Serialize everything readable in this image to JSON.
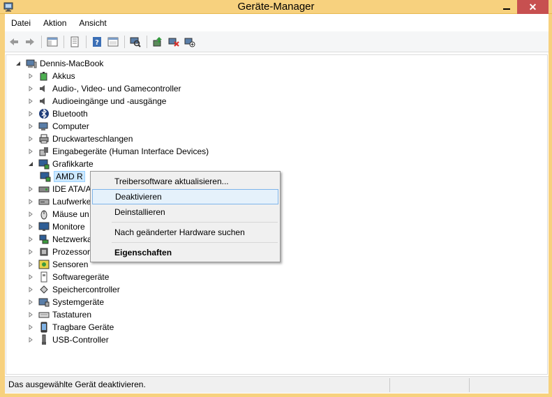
{
  "window": {
    "title": "Geräte-Manager"
  },
  "menu": [
    "Datei",
    "Aktion",
    "Ansicht"
  ],
  "toolbar": [
    "back-icon",
    "forward-icon",
    "show-hide-tree-icon",
    "properties-icon",
    "help-icon",
    "view-icon",
    "scan-hardware-icon",
    "update-driver-icon",
    "uninstall-icon",
    "disable-icon"
  ],
  "tree": {
    "root": "Dennis-MacBook",
    "items": [
      {
        "label": "Akkus",
        "icon": "battery-icon"
      },
      {
        "label": "Audio-, Video- und Gamecontroller",
        "icon": "speaker-icon"
      },
      {
        "label": "Audioeingänge und -ausgänge",
        "icon": "speaker-icon"
      },
      {
        "label": "Bluetooth",
        "icon": "bluetooth-icon"
      },
      {
        "label": "Computer",
        "icon": "computer-icon"
      },
      {
        "label": "Druckwarteschlangen",
        "icon": "printer-icon"
      },
      {
        "label": "Eingabegeräte (Human Interface Devices)",
        "icon": "hid-icon"
      },
      {
        "label": "Grafikkarte",
        "icon": "display-adapter-icon"
      },
      {
        "label": "AMD R",
        "icon": "display-adapter-icon"
      },
      {
        "label": "IDE ATA/A",
        "icon": "ide-icon"
      },
      {
        "label": "Laufwerke",
        "icon": "drive-icon"
      },
      {
        "label": "Mäuse un",
        "icon": "mouse-icon"
      },
      {
        "label": "Monitore",
        "icon": "monitor-icon"
      },
      {
        "label": "Netzwerka",
        "icon": "network-icon"
      },
      {
        "label": "Prozessore",
        "icon": "processor-icon"
      },
      {
        "label": "Sensoren",
        "icon": "sensor-icon"
      },
      {
        "label": "Softwaregeräte",
        "icon": "software-device-icon"
      },
      {
        "label": "Speichercontroller",
        "icon": "storage-icon"
      },
      {
        "label": "Systemgeräte",
        "icon": "system-icon"
      },
      {
        "label": "Tastaturen",
        "icon": "keyboard-icon"
      },
      {
        "label": "Tragbare Geräte",
        "icon": "portable-device-icon"
      },
      {
        "label": "USB-Controller",
        "icon": "usb-icon"
      }
    ]
  },
  "context_menu": {
    "update_driver": "Treibersoftware aktualisieren...",
    "disable": "Deaktivieren",
    "uninstall": "Deinstallieren",
    "scan": "Nach geänderter Hardware suchen",
    "properties": "Eigenschaften"
  },
  "status": "Das ausgewählte Gerät deaktivieren.",
  "colors": {
    "titlebar": "#f7d17e",
    "close": "#c75050",
    "selection": "#cce8ff",
    "hover": "#e5f1fb"
  }
}
